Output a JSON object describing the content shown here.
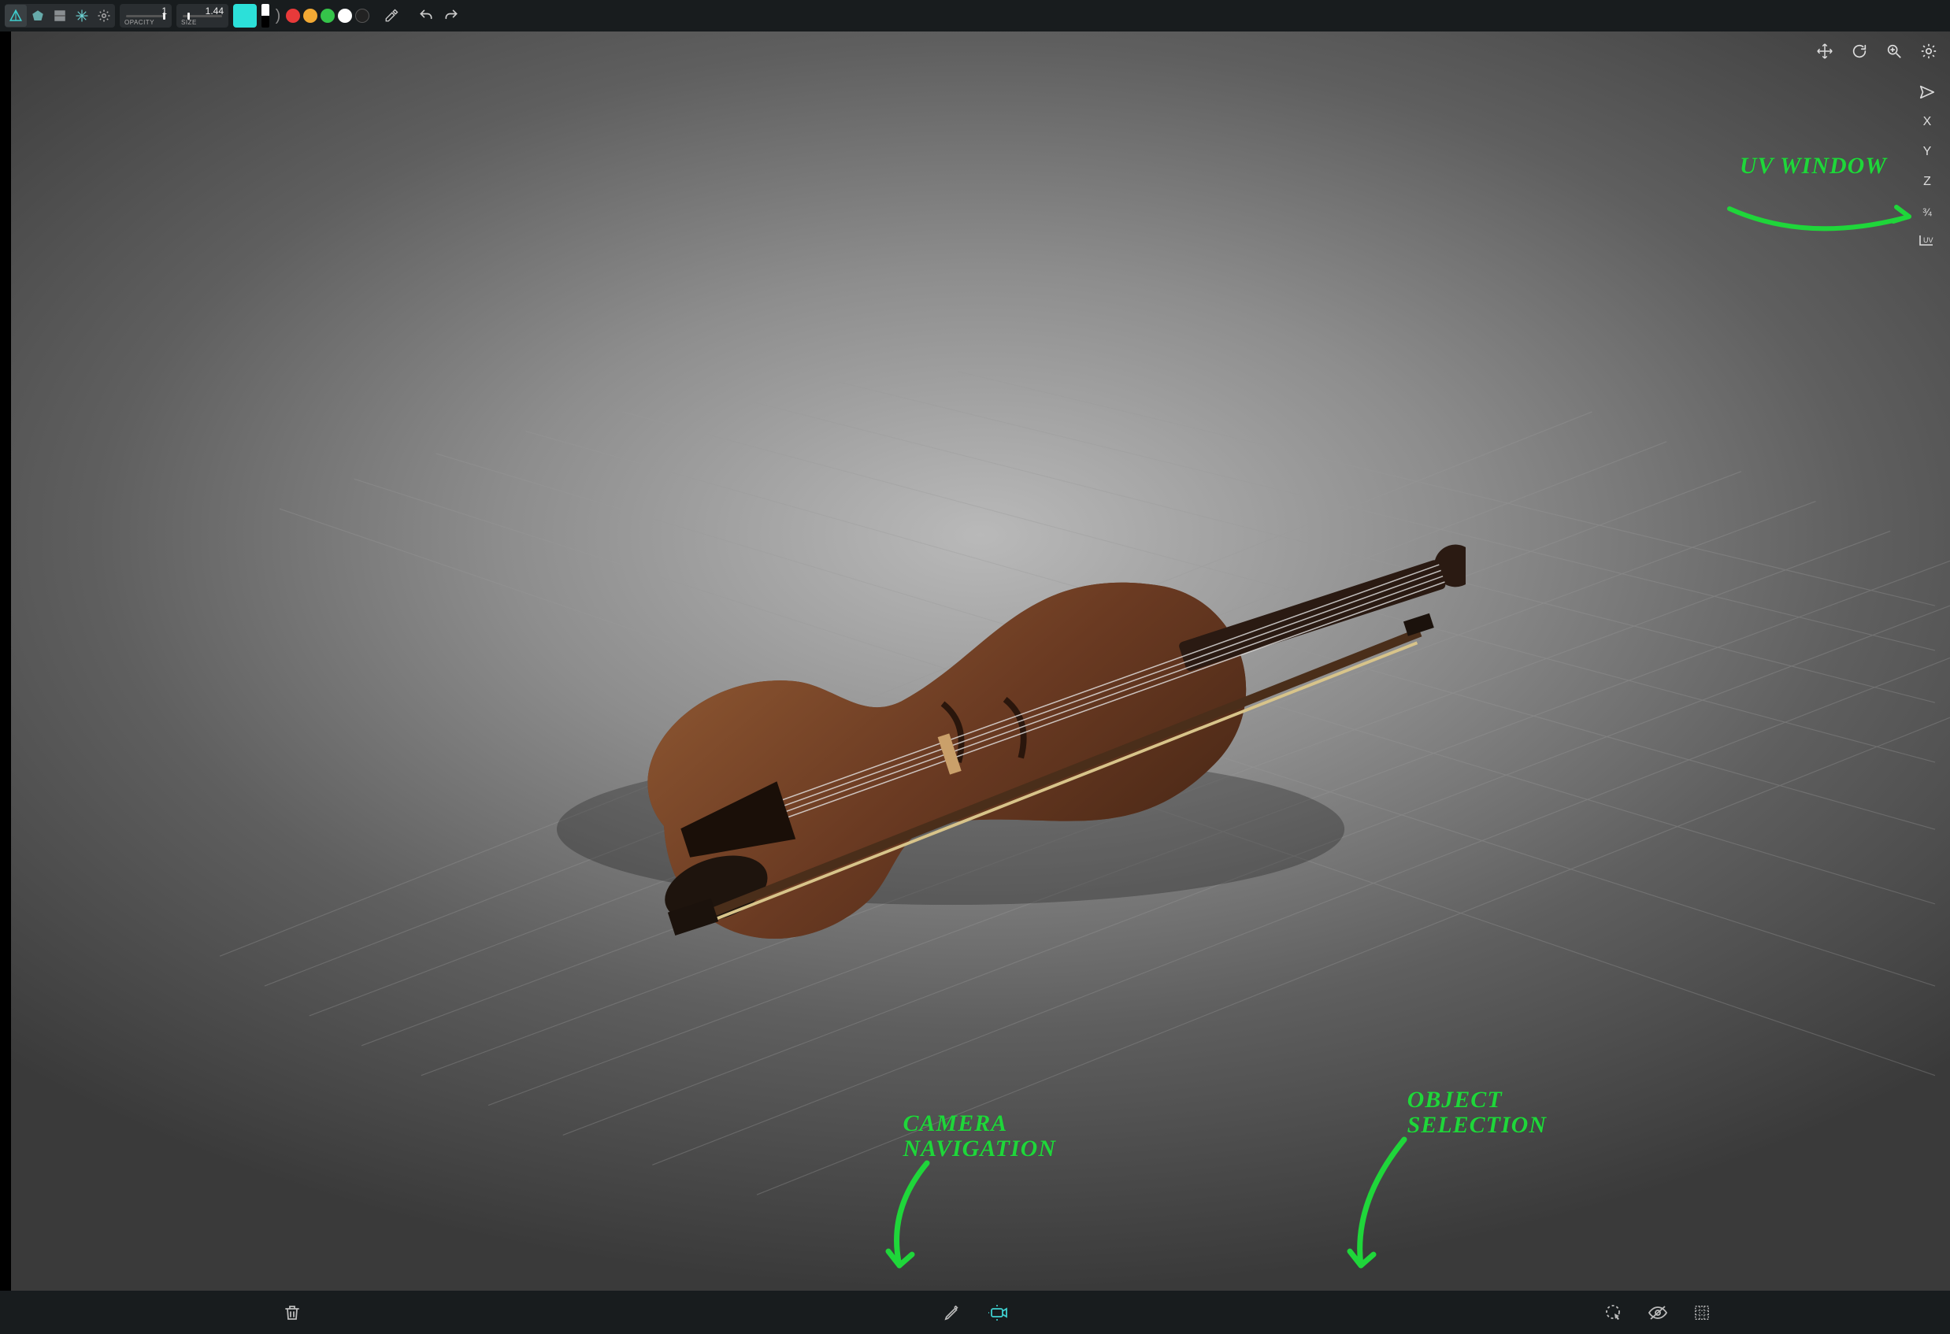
{
  "toolbar": {
    "opacity_label": "OPACITY",
    "opacity_value": "1",
    "size_label": "SIZE",
    "size_value": "1.44",
    "main_color": "#2ce0d9",
    "secondary_color_top": "#ffffff",
    "secondary_color_bottom": "#000000",
    "palette": [
      "#e83a3a",
      "#f2a934",
      "#35c44a",
      "#ffffff",
      "#222222"
    ],
    "tool_icons": {
      "prism": "prism-tool-icon",
      "polygon": "polygon-tool-icon",
      "slab": "slab-tool-icon",
      "star": "star-tool-icon",
      "gear": "settings-icon"
    }
  },
  "viewport_tools": {
    "top": [
      "move-icon",
      "reset-view-icon",
      "zoom-icon",
      "gear-icon"
    ],
    "send": "send-icon",
    "axes": {
      "x": "X",
      "y": "Y",
      "z": "Z",
      "three_quarter": "¾",
      "uv": "UV"
    }
  },
  "annotations": {
    "uv_window": "UV WINDOW",
    "camera_nav": "CAMERA\nNAVIGATION",
    "object_sel": "OBJECT\nSELECTION"
  },
  "bottom_bar": {
    "left": [
      "trash-icon"
    ],
    "center": [
      "pencil-icon",
      "camera-nav-icon"
    ],
    "right": [
      "object-select-icon",
      "eye-off-icon",
      "grid-icon"
    ]
  },
  "scene": {
    "object_name": "violin-with-bow",
    "ground": "grid-floor"
  }
}
